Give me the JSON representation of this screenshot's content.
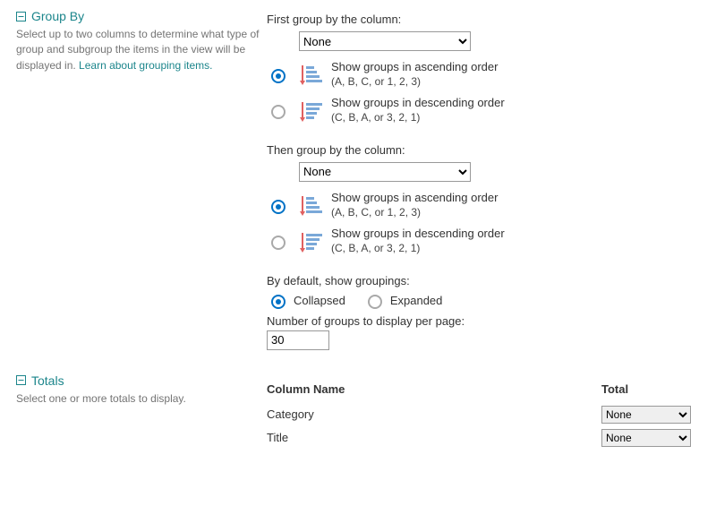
{
  "groupBy": {
    "title": "Group By",
    "help": "Select up to two columns to determine what type of group and subgroup the items in the view will be displayed in. ",
    "helpLink": "Learn about grouping items.",
    "first": {
      "label": "First group by the column:",
      "selected": "None",
      "ascText": "Show groups in ascending order",
      "ascHint": "(A, B, C, or 1, 2, 3)",
      "descText": "Show groups in descending order",
      "descHint": "(C, B, A, or 3, 2, 1)"
    },
    "then": {
      "label": "Then group by the column:",
      "selected": "None",
      "ascText": "Show groups in ascending order",
      "ascHint": "(A, B, C, or 1, 2, 3)",
      "descText": "Show groups in descending order",
      "descHint": "(C, B, A, or 3, 2, 1)"
    },
    "defaultShow": {
      "label": "By default, show groupings:",
      "collapsed": "Collapsed",
      "expanded": "Expanded"
    },
    "perPage": {
      "label": "Number of groups to display per page:",
      "value": "30"
    }
  },
  "totals": {
    "title": "Totals",
    "help": "Select one or more totals to display.",
    "headName": "Column Name",
    "headTotal": "Total",
    "rows": [
      {
        "name": "Category",
        "total": "None"
      },
      {
        "name": "Title",
        "total": "None"
      }
    ]
  }
}
